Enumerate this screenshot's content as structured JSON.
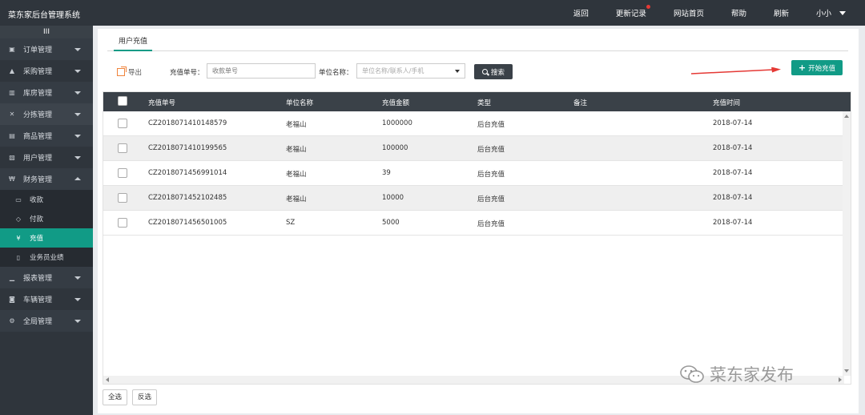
{
  "app": {
    "title": "菜东家后台管理系统"
  },
  "topnav": {
    "items": [
      "返回",
      "更新记录",
      "网站首页",
      "帮助",
      "刷新"
    ],
    "user": "小小"
  },
  "sidebar": {
    "toggle": "III",
    "items": [
      {
        "label": "订单管理",
        "icon": "order-icon"
      },
      {
        "label": "采购管理",
        "icon": "purchase-icon"
      },
      {
        "label": "库房管理",
        "icon": "warehouse-icon"
      },
      {
        "label": "分拣管理",
        "icon": "sort-icon"
      },
      {
        "label": "商品管理",
        "icon": "goods-icon"
      },
      {
        "label": "用户管理",
        "icon": "user-icon"
      },
      {
        "label": "财务管理",
        "icon": "finance-icon"
      },
      {
        "label": "收款",
        "icon": "receive-icon"
      },
      {
        "label": "付款",
        "icon": "pay-icon"
      },
      {
        "label": "充值",
        "icon": "yen-icon"
      },
      {
        "label": "业务员业绩",
        "icon": "report-doc-icon"
      },
      {
        "label": "报表管理",
        "icon": "chart-icon"
      },
      {
        "label": "车辆管理",
        "icon": "car-icon"
      },
      {
        "label": "全局管理",
        "icon": "settings-icon"
      }
    ]
  },
  "tab": {
    "label": "用户充值"
  },
  "toolbar": {
    "export": "导出",
    "recharge_no_label": "充值单号：",
    "recharge_no_placeholder": "收款单号",
    "unit_label": "单位名称：",
    "unit_placeholder": "单位名称/联系人/手机",
    "search": "搜索",
    "start": "开始充值"
  },
  "table": {
    "headers": [
      "充值单号",
      "单位名称",
      "充值金额",
      "类型",
      "备注",
      "充值时间"
    ],
    "rows": [
      {
        "no": "CZ2018071410148579",
        "unit": "老福山",
        "amount": "1000000",
        "type": "后台充值",
        "note": "",
        "time": "2018-07-14"
      },
      {
        "no": "CZ2018071410199565",
        "unit": "老福山",
        "amount": "100000",
        "type": "后台充值",
        "note": "",
        "time": "2018-07-14"
      },
      {
        "no": "CZ2018071456991014",
        "unit": "老福山",
        "amount": "39",
        "type": "后台充值",
        "note": "",
        "time": "2018-07-14"
      },
      {
        "no": "CZ2018071452102485",
        "unit": "老福山",
        "amount": "10000",
        "type": "后台充值",
        "note": "",
        "time": "2018-07-14"
      },
      {
        "no": "CZ2018071456501005",
        "unit": "SZ",
        "amount": "5000",
        "type": "后台充值",
        "note": "",
        "time": "2018-07-14"
      }
    ]
  },
  "footer": {
    "select_all": "全选",
    "invert": "反选"
  },
  "watermark": {
    "text": "菜东家发布"
  },
  "colors": {
    "accent": "#119b86",
    "dark": "#2f353c",
    "header": "#3a4148",
    "arrow": "#e53935"
  }
}
